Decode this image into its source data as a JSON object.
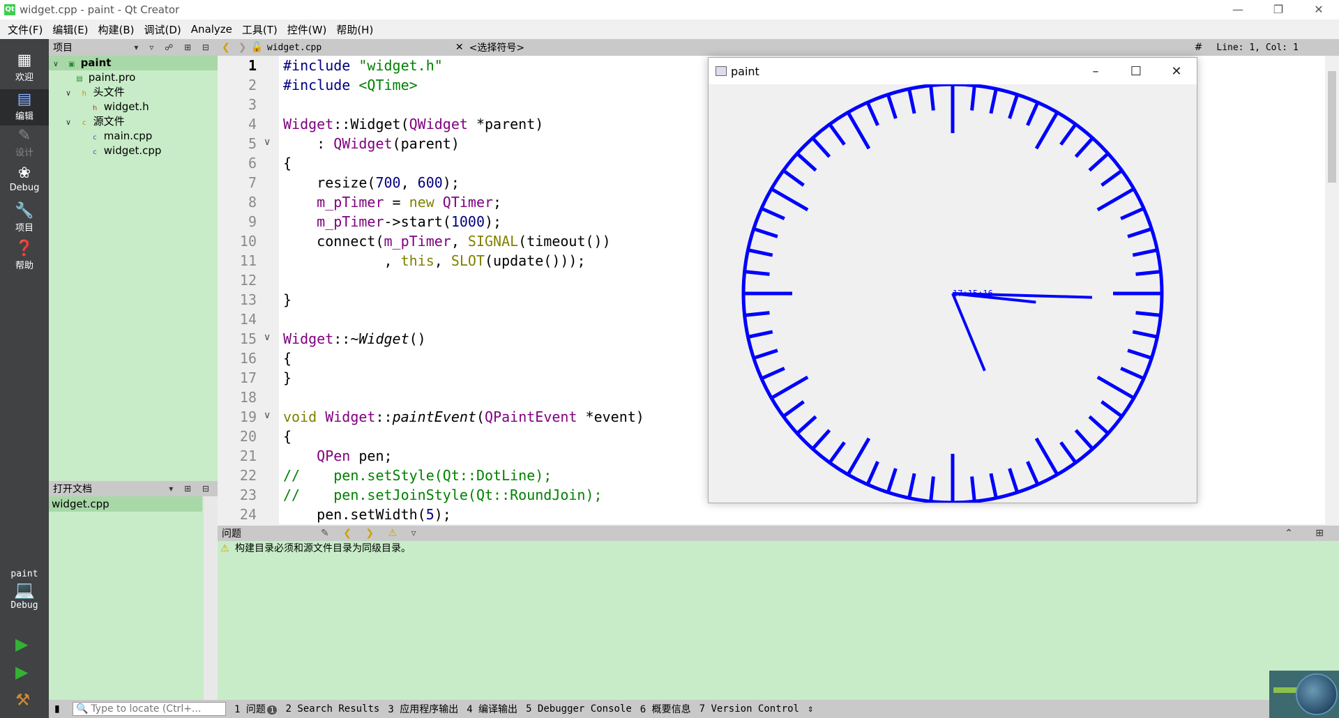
{
  "window": {
    "title": "widget.cpp - paint - Qt Creator",
    "minimize": "—",
    "maximize": "❐",
    "close": "✕"
  },
  "menu": [
    "文件(F)",
    "编辑(E)",
    "构建(B)",
    "调试(D)",
    "Analyze",
    "工具(T)",
    "控件(W)",
    "帮助(H)"
  ],
  "modes": {
    "welcome": "欢迎",
    "edit": "编辑",
    "design": "设计",
    "debug": "Debug",
    "projects": "项目",
    "help": "帮助",
    "kit_project": "paint",
    "kit_config": "Debug"
  },
  "project_pane": {
    "title": "项目",
    "tree": {
      "root": "paint",
      "pro": "paint.pro",
      "headers": "头文件",
      "widget_h": "widget.h",
      "sources": "源文件",
      "main_cpp": "main.cpp",
      "widget_cpp": "widget.cpp"
    }
  },
  "open_docs": {
    "title": "打开文档",
    "items": [
      "widget.cpp"
    ]
  },
  "editor": {
    "file": "widget.cpp",
    "symbol": "<选择符号>",
    "position": "Line: 1, Col: 1",
    "hash": "#",
    "line_numbers": [
      "1",
      "2",
      "3",
      "4",
      "5",
      "6",
      "7",
      "8",
      "9",
      "10",
      "11",
      "12",
      "13",
      "14",
      "15",
      "16",
      "17",
      "18",
      "19",
      "20",
      "21",
      "22",
      "23",
      "24"
    ],
    "current_line": 1
  },
  "paint_window": {
    "title": "paint",
    "time_text": "17:15:16",
    "hour": 17,
    "minute": 15,
    "second": 16,
    "clock_color": "#0000ff"
  },
  "issues": {
    "title": "问题",
    "message": "构建目录必须和源文件目录为同级目录。"
  },
  "statusbar": {
    "locate_placeholder": "Type to locate (Ctrl+...",
    "tabs": {
      "t1": "1 问题",
      "t1_badge": "1",
      "t2": "2 Search Results",
      "t3": "3 应用程序输出",
      "t4": "4 编译输出",
      "t5": "5 Debugger Console",
      "t6": "6 概要信息",
      "t7": "7 Version Control"
    }
  },
  "colors": {
    "pane_green": "#c8ecc8",
    "mode_bar": "#404244",
    "keyword": "#808000",
    "type": "#800080",
    "string": "#008000"
  }
}
